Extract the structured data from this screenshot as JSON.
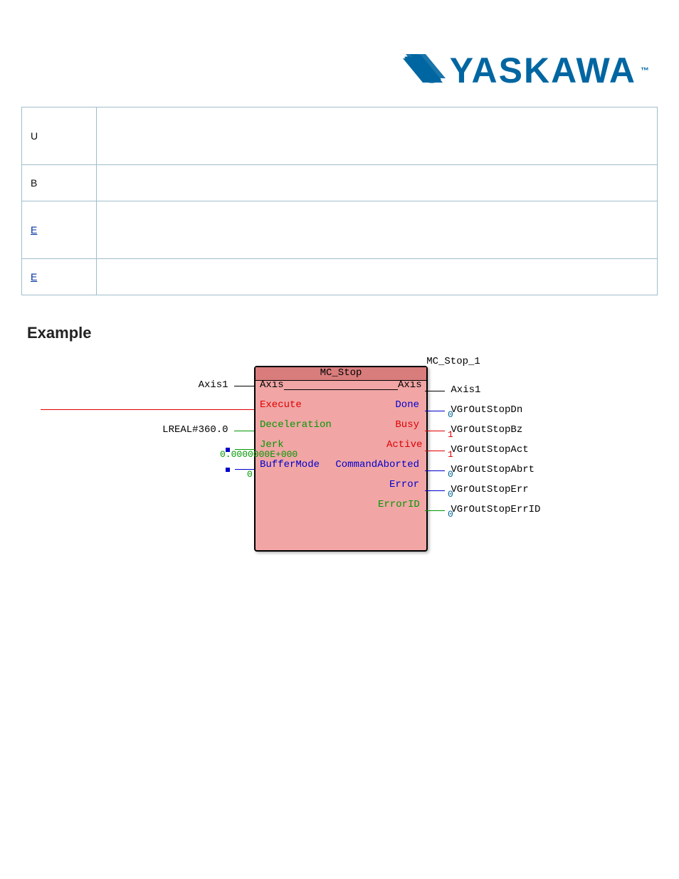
{
  "logo_text": "YASKAWA",
  "logo_tm": "™",
  "table": {
    "row1": {
      "label": "U",
      "value": ""
    },
    "row2": {
      "label": "B",
      "value": ""
    },
    "row3": {
      "label": "E",
      "value": ""
    },
    "row4": {
      "label": "E",
      "value": ""
    }
  },
  "section_title": "Example",
  "fb": {
    "instance": "MC_Stop_1",
    "type": "MC_Stop",
    "inputs": {
      "axis": {
        "label": "Axis",
        "ext": "Axis1",
        "color": "black"
      },
      "exec": {
        "label": "Execute",
        "ext": "",
        "color": "red"
      },
      "decel": {
        "label": "Deceleration",
        "ext": "LREAL#360.0",
        "color": "green"
      },
      "jerk": {
        "label": "Jerk",
        "ext": "",
        "sub": "0.0000000E+000",
        "color": "green"
      },
      "bmode": {
        "label": "BufferMode",
        "ext": "",
        "sub": "0",
        "color": "blue"
      }
    },
    "outputs": {
      "axis": {
        "label": "Axis",
        "ext": "Axis1",
        "color": "black",
        "sub": ""
      },
      "done": {
        "label": "Done",
        "ext": "VGrOutStopDn",
        "color": "blue",
        "sub": "0"
      },
      "busy": {
        "label": "Busy",
        "ext": "VGrOutStopBz",
        "color": "red",
        "sub": "1"
      },
      "active": {
        "label": "Active",
        "ext": "VGrOutStopAct",
        "color": "red",
        "sub": "1"
      },
      "abort": {
        "label": "CommandAborted",
        "ext": "VGrOutStopAbrt",
        "color": "blue",
        "sub": "0"
      },
      "error": {
        "label": "Error",
        "ext": "VGrOutStopErr",
        "color": "blue",
        "sub": "0"
      },
      "errid": {
        "label": "ErrorID",
        "ext": "VGrOutStopErrID",
        "color": "green",
        "sub": "0"
      }
    }
  }
}
